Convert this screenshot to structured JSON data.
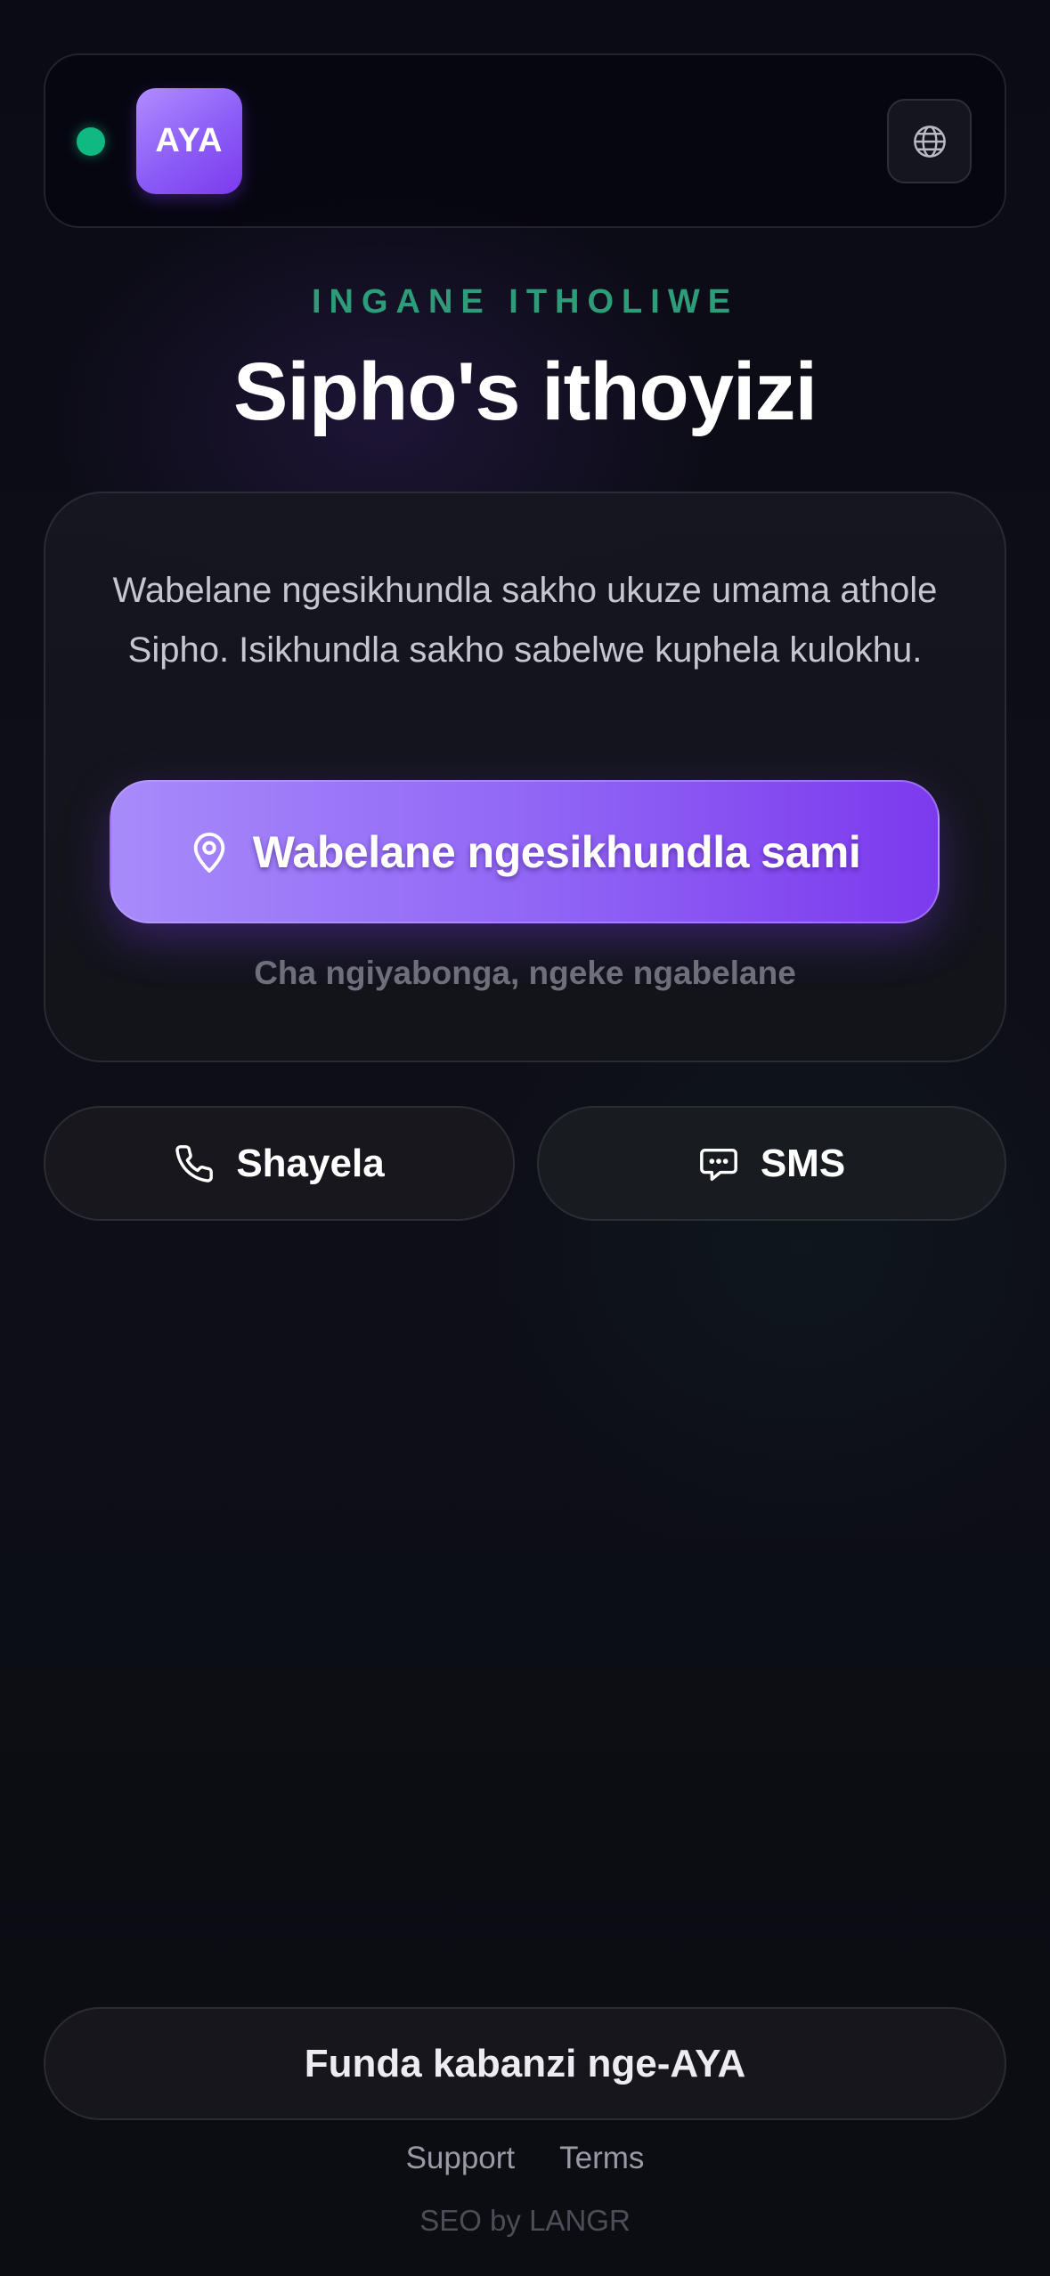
{
  "header": {
    "logo_text": "AYA",
    "status_color": "#10b981",
    "language_icon": "globe-icon"
  },
  "hero": {
    "eyebrow": "INGANE ITHOLIWE",
    "title": "Sipho's ithoyizi"
  },
  "card": {
    "description": "Wabelane ngesikhundla sakho ukuze umama athole Sipho. Isikhundla sakho sabelwe kuphela kulokhu.",
    "share_label": "Wabelane ngesikhundla sami",
    "share_icon": "map-pin-icon",
    "decline_label": "Cha ngiyabonga, ngeke ngabelane"
  },
  "actions": {
    "call_label": "Shayela",
    "call_icon": "phone-icon",
    "sms_label": "SMS",
    "sms_icon": "chat-bubble-icon"
  },
  "footer": {
    "learn_more_label": "Funda kabanzi nge-AYA",
    "links": [
      "Support",
      "Terms"
    ],
    "credit": "SEO by LANGR"
  },
  "colors": {
    "accent_purple": "#8b5cf6",
    "accent_green": "#2e9c78",
    "background": "#0c0c13"
  }
}
